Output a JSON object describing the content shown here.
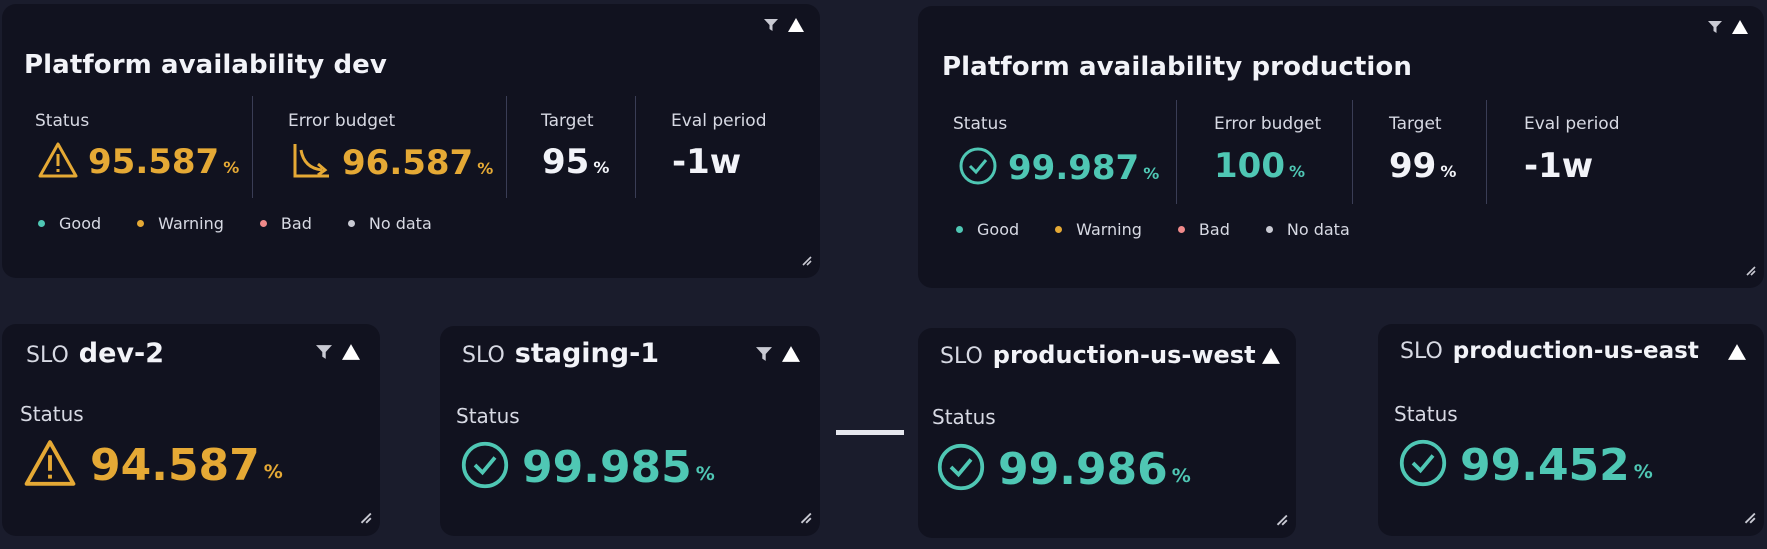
{
  "colors": {
    "background": "#1a1c2c",
    "tile": "#11121f",
    "warning": "#e5a935",
    "good": "#4fc7b4",
    "bad": "#f08a8a",
    "no_data": "#c9cad3"
  },
  "legend": [
    {
      "label": "Good",
      "color": "#4fc7b4"
    },
    {
      "label": "Warning",
      "color": "#e5a935"
    },
    {
      "label": "Bad",
      "color": "#f08a8a"
    },
    {
      "label": "No data",
      "color": "#c9cad3"
    }
  ],
  "tile_dev": {
    "title": "Platform availability dev",
    "status": {
      "label": "Status",
      "value": "95.587",
      "unit": "%",
      "icon": "warning-icon"
    },
    "error_budget": {
      "label": "Error budget",
      "value": "96.587",
      "unit": "%",
      "icon": "budget-trend-icon"
    },
    "target": {
      "label": "Target",
      "value": "95",
      "unit": "%"
    },
    "eval_period": {
      "label": "Eval period",
      "value": "-1w"
    }
  },
  "tile_prod": {
    "title": "Platform availability production",
    "status": {
      "label": "Status",
      "value": "99.987",
      "unit": "%",
      "icon": "check-circle-icon"
    },
    "error_budget": {
      "label": "Error budget",
      "value": "100",
      "unit": "%"
    },
    "target": {
      "label": "Target",
      "value": "99",
      "unit": "%"
    },
    "eval_period": {
      "label": "Eval period",
      "value": "-1w"
    }
  },
  "slo_tiles": [
    {
      "prefix": "SLO",
      "name": "dev-2",
      "status_label": "Status",
      "value": "94.587",
      "unit": "%",
      "state": "warning"
    },
    {
      "prefix": "SLO",
      "name": "staging-1",
      "status_label": "Status",
      "value": "99.985",
      "unit": "%",
      "state": "good"
    },
    {
      "prefix": "SLO",
      "name": "production-us-west",
      "status_label": "Status",
      "value": "99.986",
      "unit": "%",
      "state": "good"
    },
    {
      "prefix": "SLO",
      "name": "production-us-east",
      "status_label": "Status",
      "value": "99.452",
      "unit": "%",
      "state": "good"
    }
  ]
}
